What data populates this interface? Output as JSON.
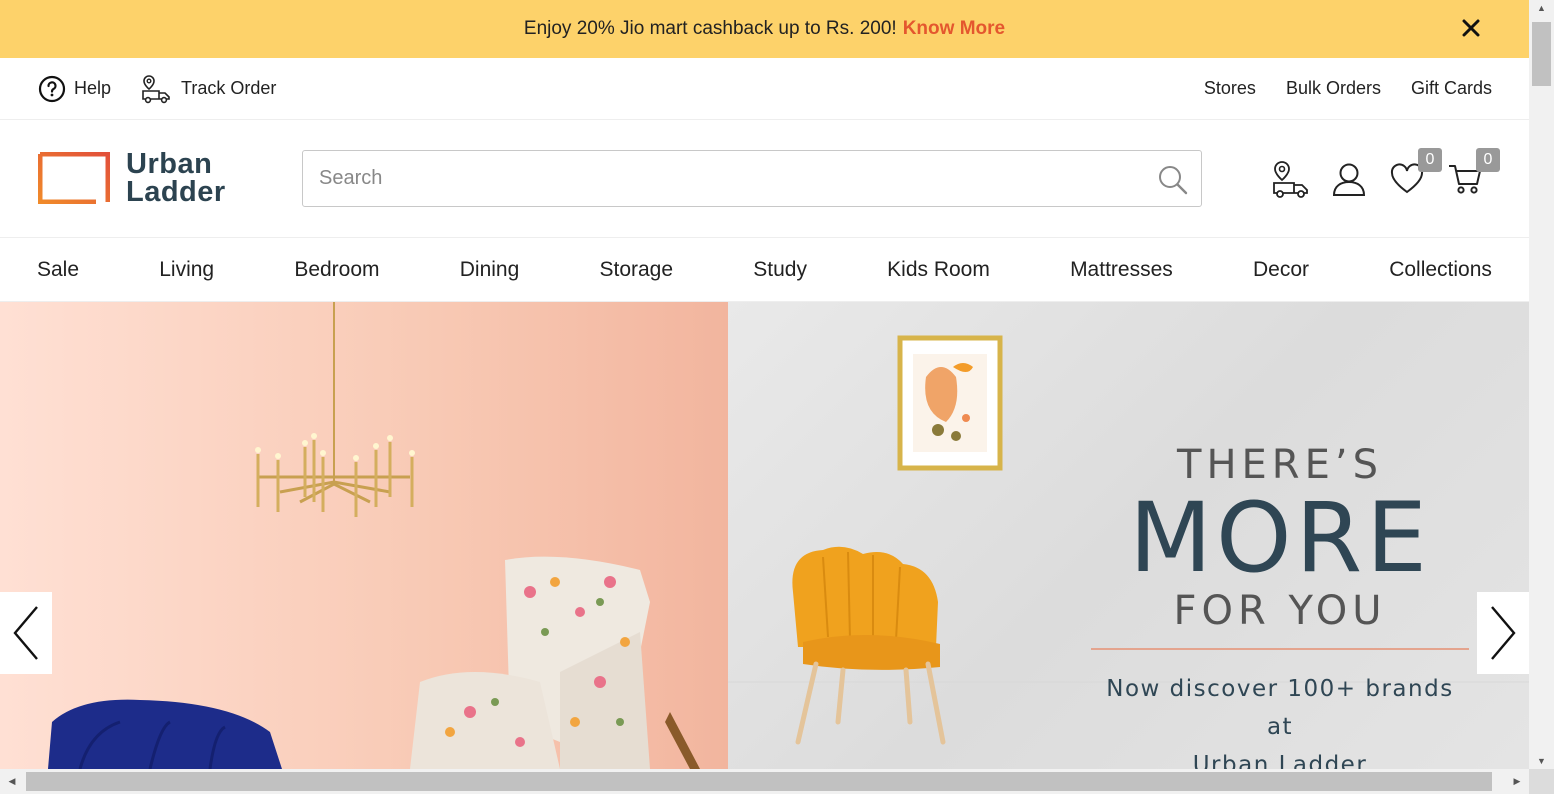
{
  "promo": {
    "text": "Enjoy 20% Jio mart cashback up to Rs. 200!",
    "link": "Know More",
    "close_icon": "close-icon"
  },
  "utility": {
    "help": "Help",
    "track_order": "Track Order",
    "stores": "Stores",
    "bulk_orders": "Bulk Orders",
    "gift_cards": "Gift Cards"
  },
  "header": {
    "logo_line1": "Urban",
    "logo_line2": "Ladder",
    "search_placeholder": "Search",
    "wishlist_count": "0",
    "cart_count": "0"
  },
  "nav": {
    "items": [
      "Sale",
      "Living",
      "Bedroom",
      "Dining",
      "Storage",
      "Study",
      "Kids Room",
      "Mattresses",
      "Decor",
      "Collections"
    ]
  },
  "hero": {
    "line1": "THERE’S",
    "line2": "MORE",
    "line3": "FOR YOU",
    "line4": "Now discover 100+ brands at",
    "line5": "Urban Ladder"
  },
  "colors": {
    "promo_bg": "#fdd26a",
    "promo_link": "#e4572e",
    "logo_text": "#2c4350",
    "hero_text": "#2f4654"
  }
}
